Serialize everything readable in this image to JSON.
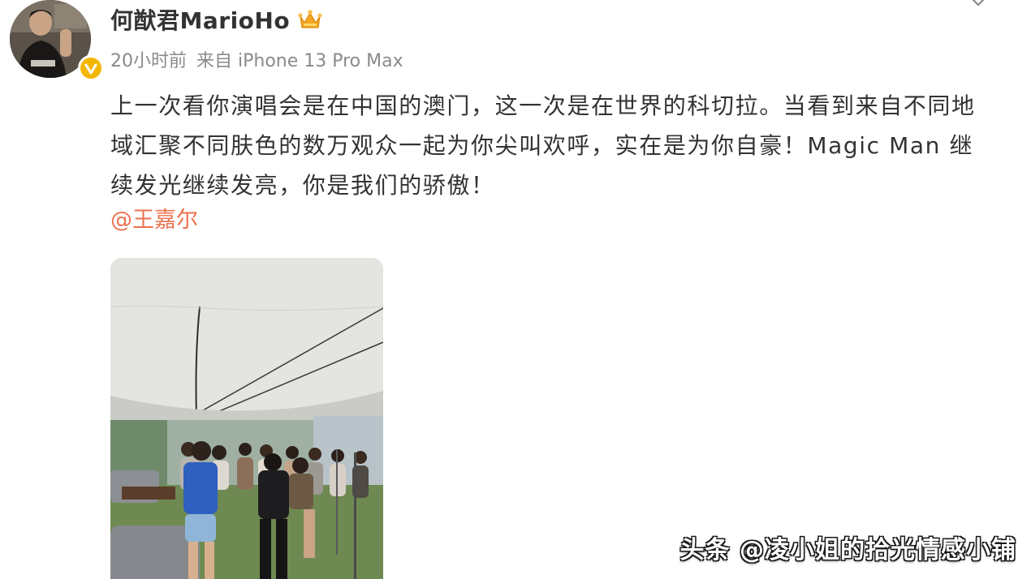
{
  "post": {
    "author": {
      "name": "何猷君MarioHo",
      "avatar_icon": "user-avatar",
      "verified_icon": "verified-badge-icon",
      "member_icon": "crown-icon"
    },
    "meta": {
      "time": "20小时前",
      "source": "来自 iPhone 13 Pro Max"
    },
    "text": "上一次看你演唱会是在中国的澳门，这一次是在世界的科切拉。当看到来自不同地域汇聚不同肤色的数万观众一起为你尖叫欢呼，实在是为你自豪！Magic Man 继续发光继续发亮，你是我们的骄傲！",
    "mention": "@王嘉尔",
    "photo": {
      "icon": "group-photo-under-tent"
    },
    "menu_icon": "chevron-down-icon"
  },
  "watermark": "头条 @凌小姐的拾光情感小铺",
  "colors": {
    "text": "#333333",
    "meta": "#8a8a8a",
    "mention": "#eb7350",
    "verified": "#f2b705"
  }
}
